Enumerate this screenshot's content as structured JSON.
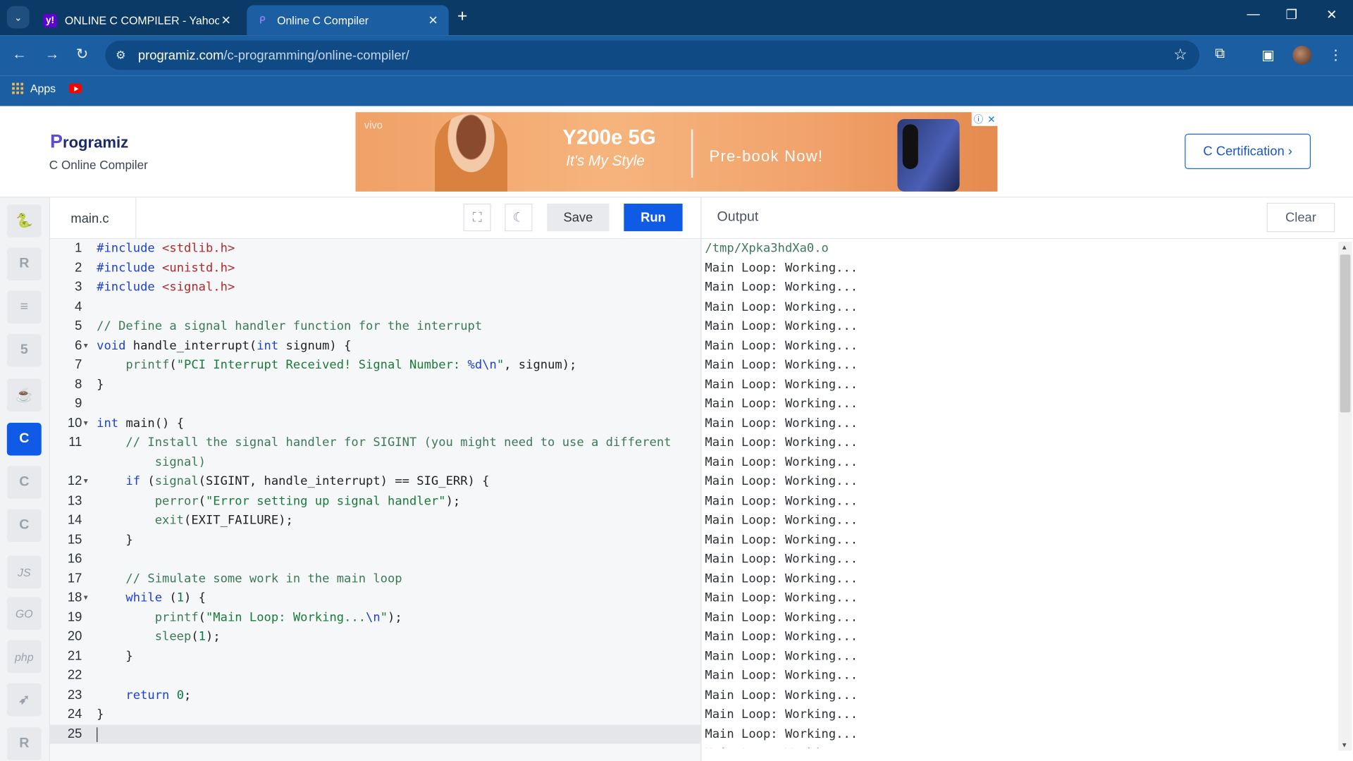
{
  "browser": {
    "tabs": [
      {
        "title": "ONLINE C COMPILER - Yahoo Ir",
        "favicon": "yahoo-icon",
        "active": false
      },
      {
        "title": "Online C Compiler",
        "favicon": "programiz-icon",
        "active": true
      }
    ],
    "url_host": "programiz.com",
    "url_path": "/c-programming/online-compiler/",
    "bookmarks": {
      "apps_label": "Apps"
    }
  },
  "header": {
    "logo": "rogramiz",
    "logo_initial": "P",
    "subtitle": "C Online Compiler",
    "certification_label": "C Certification ›",
    "ad": {
      "brand": "vivo",
      "model": "Y200e 5G",
      "tagline": "It's My Style",
      "cta": "Pre-book Now!"
    }
  },
  "sidebar": {
    "languages": [
      "python",
      "r",
      "sql",
      "html",
      "java",
      "c",
      "c++",
      "c#",
      "js",
      "go",
      "php",
      "swift",
      "rust"
    ],
    "active": "c",
    "js_label": "JS",
    "go_label": "GO",
    "php_label": "php"
  },
  "editor": {
    "filename": "main.c",
    "save_label": "Save",
    "run_label": "Run",
    "current_line": 25
  },
  "output": {
    "label": "Output",
    "clear_label": "Clear",
    "path_line": "/tmp/Xpka3hdXa0.o",
    "loop_line": "Main Loop: Working..."
  }
}
